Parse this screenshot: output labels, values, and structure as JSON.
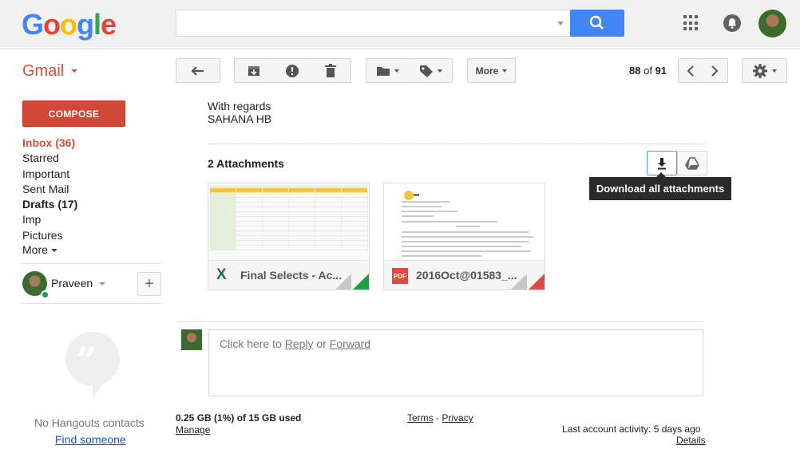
{
  "header": {
    "logo_letters": [
      "G",
      "o",
      "o",
      "g",
      "l",
      "e"
    ],
    "logo_colors": [
      "#4285f4",
      "#ea4335",
      "#fbbc05",
      "#4285f4",
      "#34a853",
      "#ea4335"
    ],
    "search_value": "",
    "search_button_color": "#4285f4"
  },
  "toolbar": {
    "app_label": "Gmail",
    "more_label": "More",
    "pager_current": "88",
    "pager_of": "of",
    "pager_total": "91"
  },
  "sidebar": {
    "compose_label": "COMPOSE",
    "items": [
      {
        "label": "Inbox (36)"
      },
      {
        "label": "Starred"
      },
      {
        "label": "Important"
      },
      {
        "label": "Sent Mail"
      },
      {
        "label": "Drafts (17)"
      },
      {
        "label": "Imp"
      },
      {
        "label": "Pictures"
      },
      {
        "label": "More"
      }
    ],
    "hangouts_user": "Praveen",
    "add_label": "+",
    "no_contacts": "No Hangouts contacts",
    "find_someone": "Find someone"
  },
  "message": {
    "signature_line1": "With regards",
    "signature_line2": "SAHANA HB",
    "attachments_title": "2 Attachments",
    "download_tooltip": "Download all attachments",
    "attachments": [
      {
        "name": "Final Selects - Ac...",
        "type_icon": "excel-icon",
        "badge": "X",
        "accent": "#1e9e45"
      },
      {
        "name": "2016Oct@01583_...",
        "type_icon": "pdf-icon",
        "badge": "PDF",
        "accent": "#dc4b3f"
      }
    ]
  },
  "reply": {
    "prefix": "Click here to",
    "reply_link": "Reply",
    "or": "or",
    "forward_link": "Forward"
  },
  "footer": {
    "storage": "0.25 GB (1%) of 15 GB used",
    "manage": "Manage",
    "terms": "Terms",
    "separator": "-",
    "privacy": "Privacy",
    "activity": "Last account activity: 5 days ago",
    "details": "Details"
  }
}
